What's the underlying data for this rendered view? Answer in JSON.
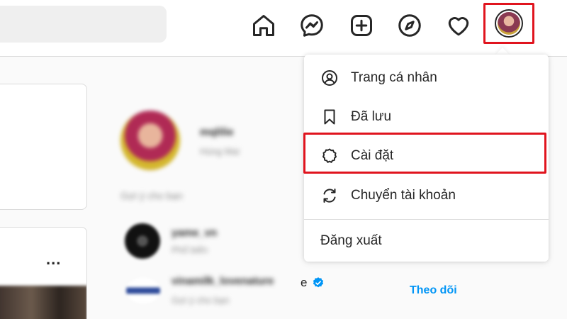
{
  "nav": {
    "icons": [
      "home-icon",
      "messenger-icon",
      "new-post-icon",
      "explore-icon",
      "activity-heart-icon"
    ],
    "avatar_highlight_color": "#e0141e"
  },
  "sidebar_profile": {
    "username": "mqlilie",
    "fullname": "Hùng Mai",
    "suggest_title": "Gợi ý cho bạn"
  },
  "suggestions": [
    {
      "name": "yame_vn",
      "subtitle": "Phổ biến"
    },
    {
      "name": "vinamilk_lovenature",
      "name_tail": "e",
      "subtitle": "Gợi ý cho bạn",
      "verified": true,
      "action": "Theo dõi"
    }
  ],
  "post": {
    "more_label": "..."
  },
  "dropdown": {
    "items": [
      {
        "label": "Trang cá nhân",
        "icon": "profile-icon"
      },
      {
        "label": "Đã lưu",
        "icon": "bookmark-icon"
      },
      {
        "label": "Cài đặt",
        "icon": "settings-gear-icon",
        "highlighted": true
      },
      {
        "label": "Chuyển tài khoản",
        "icon": "switch-account-icon"
      }
    ],
    "logout_label": "Đăng xuất"
  },
  "colors": {
    "accent_blue": "#0095f6",
    "highlight_red": "#e0141e",
    "text": "#262626",
    "muted": "#8e8e8e"
  }
}
